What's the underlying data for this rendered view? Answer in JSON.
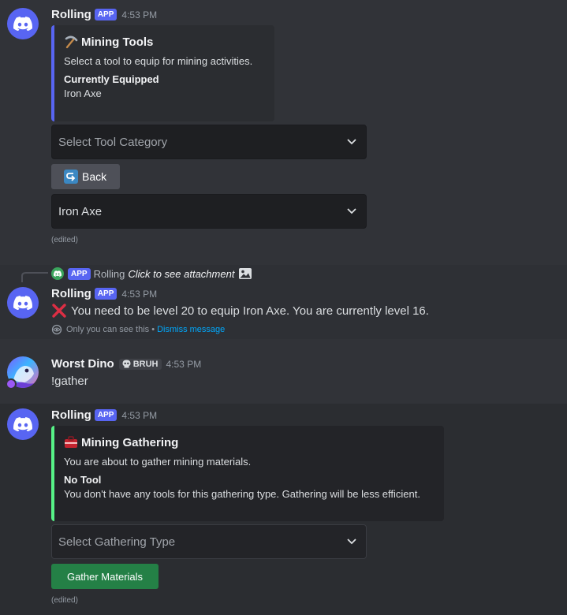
{
  "messages": [
    {
      "author": "Rolling",
      "badge": "APP",
      "time": "4:53 PM",
      "embed": {
        "emoji": "⛏️",
        "title": "Mining Tools",
        "description": "Select a tool to equip for mining activities.",
        "field_name": "Currently Equipped",
        "field_value": "Iron Axe",
        "color": "#5865f2"
      },
      "select1_placeholder": "Select Tool Category",
      "back_label": "Back",
      "select2_value": "Iron Axe",
      "edited": "(edited)"
    },
    {
      "reply": {
        "badge": "APP",
        "author": "Rolling",
        "text": "Click to see attachment"
      },
      "author": "Rolling",
      "badge": "APP",
      "time": "4:53 PM",
      "content": "You need to be level 20 to equip Iron Axe. You are currently level 16.",
      "ephemeral_note": "Only you can see this •",
      "dismiss_label": "Dismiss message"
    },
    {
      "author": "Worst Dino",
      "tag": "BRUH",
      "time": "4:53 PM",
      "content": "!gather"
    },
    {
      "author": "Rolling",
      "badge": "APP",
      "time": "4:53 PM",
      "embed": {
        "title": "Mining Gathering",
        "description": "You are about to gather mining materials.",
        "field_name": "No Tool",
        "field_value": "You don't have any tools for this gathering type. Gathering will be less efficient.",
        "color": "#57f287"
      },
      "select_placeholder": "Select Gathering Type",
      "button_label": "Gather Materials",
      "edited": "(edited)"
    }
  ]
}
